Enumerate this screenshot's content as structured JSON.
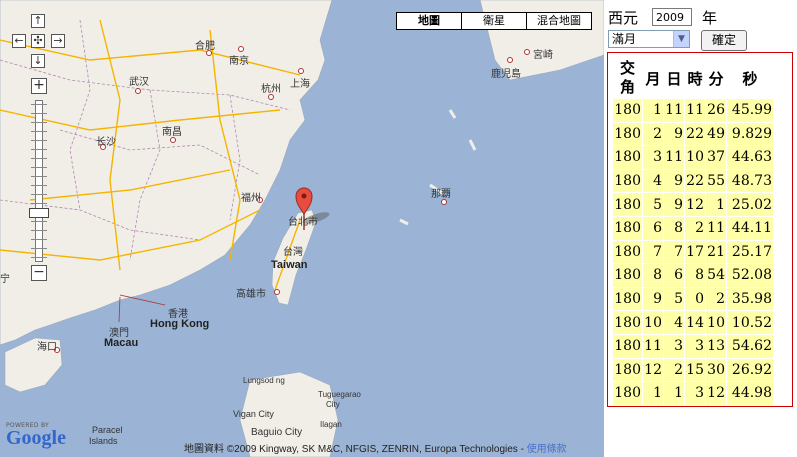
{
  "map": {
    "map_types": [
      {
        "label": "地圖",
        "active": true
      },
      {
        "label": "衛星",
        "active": false
      },
      {
        "label": "混合地圖",
        "active": false
      }
    ],
    "pan": {
      "up": "↑",
      "down": "↓",
      "left": "←",
      "right": "→",
      "center": "✣"
    },
    "zoom": {
      "in": "+",
      "out": "−"
    },
    "places": {
      "hefei": "合肥",
      "nanjing": "南京",
      "shanghai": "上海",
      "hangzhou": "杭州",
      "wuhan": "武汉",
      "nanchang": "南昌",
      "changsha": "长沙",
      "fuzhou": "福州",
      "taipei": "台北市",
      "taiwan_zh": "台灣",
      "taiwan_en": "Taiwan",
      "kaohsiung": "高雄市",
      "hongkong_zh": "香港",
      "hongkong_en": "Hong Kong",
      "macau_zh": "澳門",
      "macau_en": "Macau",
      "haikou": "海口",
      "naha": "那覇",
      "miyazaki": "宮崎",
      "kagoshima": "鹿児島",
      "lungsod": "Lungsod ng",
      "tuguegarao": "Tuguegarao",
      "city": "City",
      "vigan": "Vigan City",
      "ilagan": "Ilagan",
      "baguio": "Baguio City",
      "paracel": "Paracel",
      "islands": "Islands",
      "ning": "宁"
    },
    "powered_by": "POWERED BY",
    "logo": "Google",
    "attribution": "地圖資料 ©2009 Kingway, SK M&C, NFGIS, ZENRIN, Europa Technologies -",
    "terms": "使用條款",
    "colors": {
      "water": "#9bb4d6",
      "land": "#f1eee8",
      "highway": "#f5b400",
      "border": "#b088b0",
      "marker": "#e74c3c"
    }
  },
  "form": {
    "era_label": "西元",
    "year_value": "2009",
    "year_unit": "年",
    "phase_selected": "滿月",
    "confirm_label": "確定"
  },
  "table": {
    "headers": [
      "交角",
      "月",
      "日",
      "時",
      "分",
      "秒"
    ],
    "rows": [
      [
        "180",
        "1",
        "11",
        "11",
        "26",
        "45.99"
      ],
      [
        "180",
        "2",
        "9",
        "22",
        "49",
        "9.829"
      ],
      [
        "180",
        "3",
        "11",
        "10",
        "37",
        "44.63"
      ],
      [
        "180",
        "4",
        "9",
        "22",
        "55",
        "48.73"
      ],
      [
        "180",
        "5",
        "9",
        "12",
        "1",
        "25.02"
      ],
      [
        "180",
        "6",
        "8",
        "2",
        "11",
        "44.11"
      ],
      [
        "180",
        "7",
        "7",
        "17",
        "21",
        "25.17"
      ],
      [
        "180",
        "8",
        "6",
        "8",
        "54",
        "52.08"
      ],
      [
        "180",
        "9",
        "5",
        "0",
        "2",
        "35.98"
      ],
      [
        "180",
        "10",
        "4",
        "14",
        "10",
        "10.52"
      ],
      [
        "180",
        "11",
        "3",
        "3",
        "13",
        "54.62"
      ],
      [
        "180",
        "12",
        "2",
        "15",
        "30",
        "26.92"
      ],
      [
        "180",
        "1",
        "1",
        "3",
        "12",
        "44.98"
      ]
    ],
    "row_color": "#ffffa8",
    "border_color": "#cc0000"
  }
}
